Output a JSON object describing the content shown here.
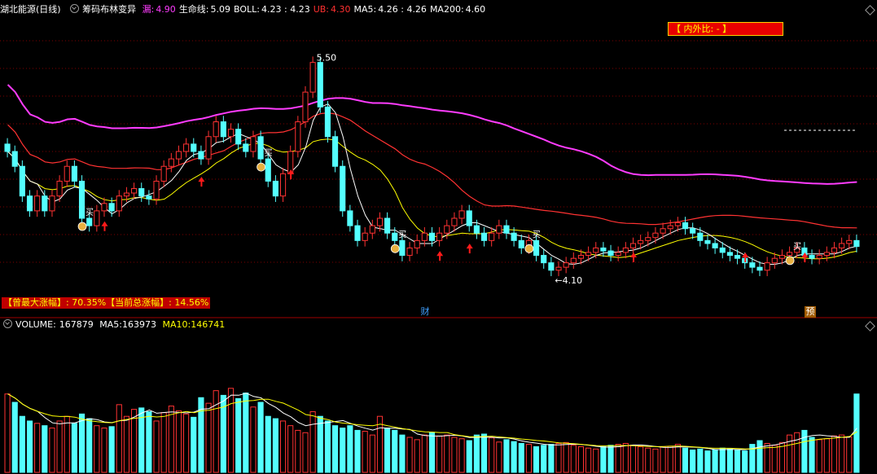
{
  "header": {
    "stock_name": "湖北能源(日线)",
    "indicator_name": "筹码布林变异",
    "items": [
      {
        "key": "leak",
        "label": "漏:",
        "value": "4.90",
        "label_color": "#ff3cff",
        "value_color": "#ff3cff"
      },
      {
        "key": "life",
        "label": "生命线:",
        "value": "5.09",
        "label_color": "#ffffff",
        "value_color": "#ffffff"
      },
      {
        "key": "boll",
        "label": "BOLL:",
        "value": "4.23 : 4.23",
        "label_color": "#ffffff",
        "value_color": "#ffffff"
      },
      {
        "key": "ub",
        "label": "UB:",
        "value": "4.30",
        "label_color": "#ff3030",
        "value_color": "#ff3030"
      },
      {
        "key": "ma5",
        "label": "MA5:",
        "value": "4.26 : 4.26",
        "label_color": "#ffffff",
        "value_color": "#ffffff"
      },
      {
        "key": "ma200",
        "label": "MA200:",
        "value": "4.60",
        "label_color": "#ffffff",
        "value_color": "#ffffff"
      }
    ]
  },
  "nei_wai": "【 内外比:  -  】",
  "stats_text": "【曾最大涨幅】: 70.35%【当前总涨幅】: 14.56%",
  "event_tags": {
    "cai": "财",
    "yu": "预"
  },
  "price_annotations": {
    "high": "5.50",
    "low": "4.10",
    "buy": "买"
  },
  "volume_header": {
    "title": "VOLUME:",
    "value": "167879",
    "ma5_label": "MA5:",
    "ma5_value": "163973",
    "ma10_label": "MA10:",
    "ma10_value": "146741"
  },
  "colors": {
    "up": "#ff3232",
    "down": "#54ffff",
    "ma200": "#ff3cff",
    "life_line": "#ff3232",
    "yellow": "#ffff00",
    "white": "#ffffff",
    "grid": "#800000"
  },
  "chart_data": {
    "type": "candlestick",
    "price_ylim": [
      4.0,
      5.8
    ],
    "close": [
      4.9,
      4.8,
      4.6,
      4.5,
      4.6,
      4.5,
      4.6,
      4.7,
      4.8,
      4.7,
      4.45,
      4.4,
      4.5,
      4.55,
      4.5,
      4.6,
      4.62,
      4.65,
      4.6,
      4.58,
      4.7,
      4.8,
      4.85,
      4.9,
      4.95,
      4.9,
      4.85,
      5.0,
      5.1,
      5.0,
      5.05,
      4.95,
      4.9,
      5.0,
      4.85,
      4.7,
      4.6,
      4.75,
      4.9,
      5.1,
      5.3,
      5.5,
      5.2,
      5.0,
      4.8,
      4.5,
      4.4,
      4.3,
      4.35,
      4.4,
      4.45,
      4.35,
      4.3,
      4.2,
      4.25,
      4.3,
      4.35,
      4.3,
      4.35,
      4.4,
      4.45,
      4.5,
      4.4,
      4.35,
      4.3,
      4.35,
      4.4,
      4.35,
      4.3,
      4.25,
      4.3,
      4.2,
      4.15,
      4.1,
      4.12,
      4.15,
      4.18,
      4.2,
      4.22,
      4.25,
      4.23,
      4.2,
      4.22,
      4.25,
      4.28,
      4.3,
      4.32,
      4.35,
      4.38,
      4.4,
      4.42,
      4.38,
      4.35,
      4.3,
      4.28,
      4.25,
      4.22,
      4.2,
      4.18,
      4.15,
      4.12,
      4.1,
      4.15,
      4.18,
      4.2,
      4.22,
      4.25,
      4.2,
      4.18,
      4.2,
      4.22,
      4.25,
      4.28,
      4.3,
      4.26
    ],
    "volume_ylim": [
      0,
      300000
    ],
    "volume_values": [
      167879,
      150000,
      120000,
      110000,
      105000,
      100000,
      95000,
      110000,
      120000,
      105000,
      125000,
      115000,
      100000,
      95000,
      98000,
      145000,
      120000,
      135000,
      138000,
      130000,
      110000,
      128000,
      142000,
      132000,
      125000,
      118000,
      160000,
      148000,
      175000,
      165000,
      180000,
      158000,
      170000,
      140000,
      150000,
      120000,
      115000,
      110000,
      100000,
      90000,
      85000,
      130000,
      120000,
      110000,
      100000,
      95000,
      100000,
      90000,
      88000,
      80000,
      120000,
      95000,
      90000,
      80000,
      75000,
      70000,
      80000,
      85000,
      78000,
      80000,
      75000,
      72000,
      68000,
      80000,
      82000,
      74000,
      65000,
      70000,
      66000,
      62000,
      60000,
      55000,
      58000,
      60000,
      62000,
      64000,
      58000,
      55000,
      52000,
      50000,
      55000,
      58000,
      60000,
      62000,
      58000,
      55000,
      52000,
      50000,
      54000,
      56000,
      60000,
      52000,
      48000,
      50000,
      46000,
      48000,
      52000,
      50000,
      48000,
      46000,
      60000,
      68000,
      62000,
      58000,
      64000,
      80000,
      85000,
      90000,
      75000,
      70000,
      72000,
      78000,
      80000,
      76000,
      167879
    ],
    "ma5_label": "MA5",
    "ma10_label": "MA10"
  }
}
